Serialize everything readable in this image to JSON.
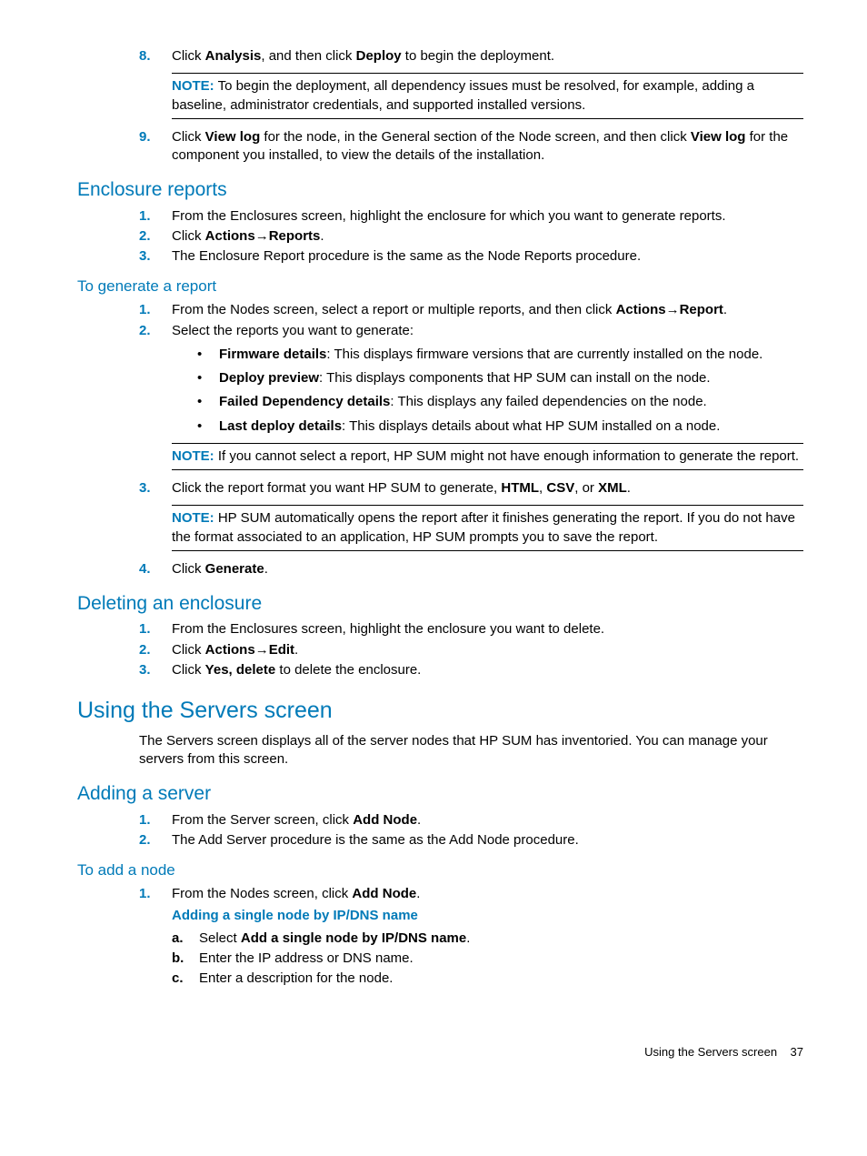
{
  "step8": {
    "num": "8.",
    "text_a": "Click ",
    "b1": "Analysis",
    "text_b": ", and then click ",
    "b2": "Deploy",
    "text_c": " to begin the deployment.",
    "note_lbl": "NOTE:",
    "note_text": "   To begin the deployment, all dependency issues must be resolved, for example, adding a baseline, administrator credentials, and supported installed versions."
  },
  "step9": {
    "num": "9.",
    "text_a": "Click ",
    "b1": "View log",
    "text_b": " for the node, in the General section of the Node screen, and then click ",
    "b2": "View log",
    "text_c": " for the component you installed, to view the details of the installation."
  },
  "enclosure_reports": {
    "heading": "Enclosure reports",
    "items": [
      {
        "num": "1.",
        "text": "From the Enclosures screen, highlight the enclosure for which you want to generate reports."
      },
      {
        "num": "2.",
        "pre": "Click ",
        "b1": "Actions",
        "arrow": "→",
        "b2": "Reports",
        "post": "."
      },
      {
        "num": "3.",
        "text": "The Enclosure Report procedure is the same as the Node Reports procedure."
      }
    ]
  },
  "gen_report": {
    "heading": "To generate a report",
    "s1": {
      "num": "1.",
      "pre": "From the Nodes screen, select a report or multiple reports, and then click ",
      "b1": "Actions",
      "arrow": "→",
      "b2": "Report",
      "post": "."
    },
    "s2": {
      "num": "2.",
      "text": "Select the reports you want to generate:"
    },
    "bullets": [
      {
        "b": "Firmware details",
        "t": ": This displays firmware versions that are currently installed on the node."
      },
      {
        "b": "Deploy preview",
        "t": ": This displays components that HP SUM can install on the node."
      },
      {
        "b": "Failed Dependency details",
        "t": ": This displays any failed dependencies on the node."
      },
      {
        "b": "Last deploy details",
        "t": ": This displays details about what HP SUM installed on a node."
      }
    ],
    "note1_lbl": "NOTE:",
    "note1_text": "   If you cannot select a report, HP SUM might not have enough information to generate the report.",
    "s3": {
      "num": "3.",
      "pre": "Click the report format you want HP SUM to generate, ",
      "b1": "HTML",
      "sep1": ", ",
      "b2": "CSV",
      "sep2": ", or ",
      "b3": "XML",
      "post": "."
    },
    "note2_lbl": "NOTE:",
    "note2_text": "   HP SUM automatically opens the report after it finishes generating the report. If you do not have the format associated to an application, HP SUM prompts you to save the report.",
    "s4": {
      "num": "4.",
      "pre": "Click ",
      "b1": "Generate",
      "post": "."
    }
  },
  "del_enclosure": {
    "heading": "Deleting an enclosure",
    "s1": {
      "num": "1.",
      "text": "From the Enclosures screen, highlight the enclosure you want to delete."
    },
    "s2": {
      "num": "2.",
      "pre": "Click ",
      "b1": "Actions",
      "arrow": "→",
      "b2": "Edit",
      "post": "."
    },
    "s3": {
      "num": "3.",
      "pre": "Click ",
      "b1": "Yes, delete",
      "post": " to delete the enclosure."
    }
  },
  "servers": {
    "heading": "Using the Servers screen",
    "para": "The Servers screen displays all of the server nodes that HP SUM has inventoried. You can manage your servers from this screen."
  },
  "add_server": {
    "heading": "Adding a server",
    "s1": {
      "num": "1.",
      "pre": "From the Server screen, click ",
      "b1": "Add Node",
      "post": "."
    },
    "s2": {
      "num": "2.",
      "text": "The Add Server procedure is the same as the Add Node procedure."
    }
  },
  "add_node": {
    "heading": "To add a node",
    "s1": {
      "num": "1.",
      "pre": "From the Nodes screen, click ",
      "b1": "Add Node",
      "post": "."
    },
    "sub_heading": "Adding a single node by IP/DNS name",
    "a": {
      "m": "a.",
      "pre": "Select ",
      "b1": "Add a single node by IP/DNS name",
      "post": "."
    },
    "b": {
      "m": "b.",
      "text": "Enter the IP address or DNS name."
    },
    "c": {
      "m": "c.",
      "text": "Enter a description for the node."
    }
  },
  "footer": {
    "label": "Using the Servers screen",
    "page": "37"
  }
}
